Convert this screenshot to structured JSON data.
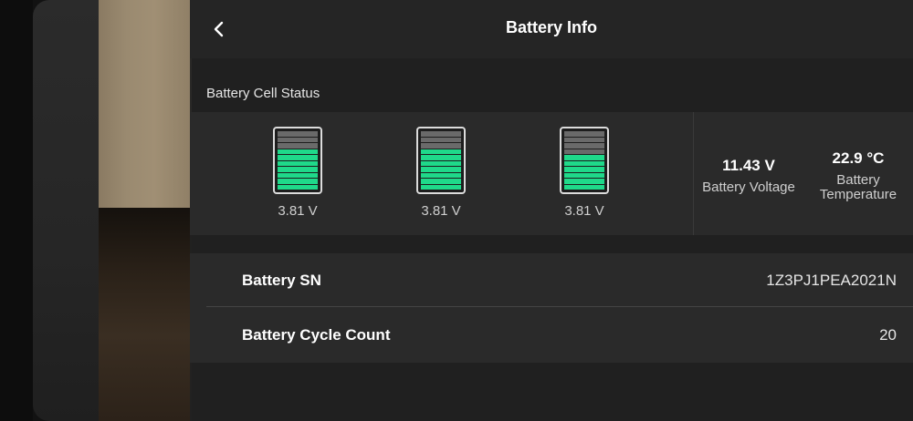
{
  "header": {
    "title": "Battery Info"
  },
  "section": {
    "label": "Battery Cell Status"
  },
  "cells": [
    {
      "voltage": "3.81 V",
      "level": 0.7
    },
    {
      "voltage": "3.81 V",
      "level": 0.7
    },
    {
      "voltage": "3.81 V",
      "level": 0.6
    }
  ],
  "stats": {
    "voltage": {
      "value": "11.43 V",
      "label": "Battery Voltage"
    },
    "temperature": {
      "value": "22.9 °C",
      "label_line1": "Battery",
      "label_line2": "Temperature"
    }
  },
  "info": {
    "sn": {
      "label": "Battery SN",
      "value": "1Z3PJ1PEA2021N"
    },
    "cycles": {
      "label": "Battery Cycle Count",
      "value": "20"
    }
  },
  "colors": {
    "cell_fill": "#1fd98a",
    "cell_empty": "#6a6a6a"
  },
  "icons": {
    "back": "chevron-left-icon"
  }
}
